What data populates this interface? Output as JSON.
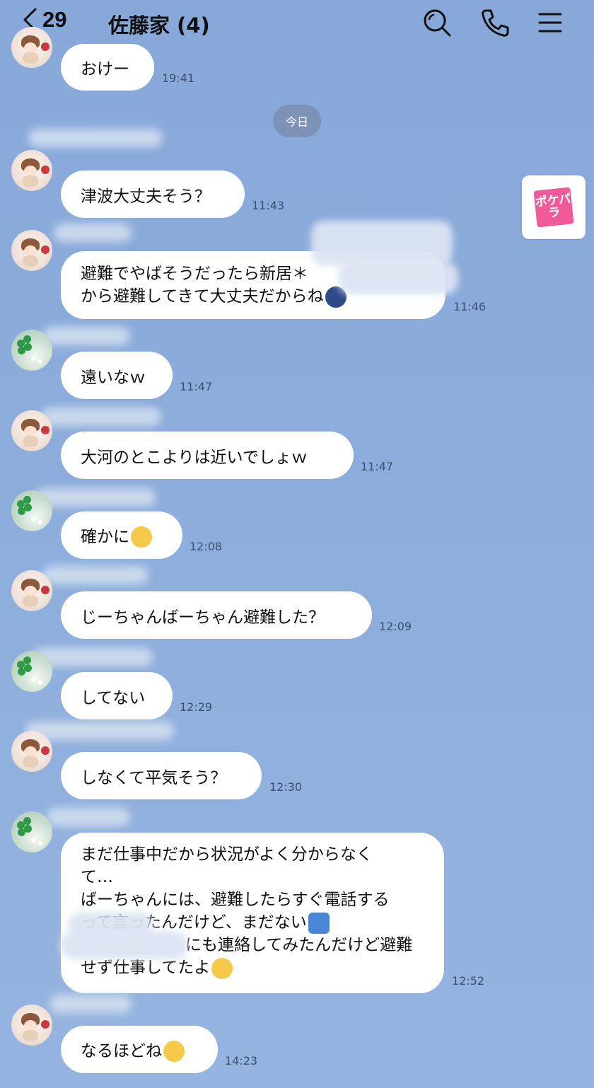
{
  "header": {
    "unread_count": "29",
    "title": "佐藤家 (4)",
    "icons": [
      "chevron-left-icon",
      "search-icon",
      "phone-icon",
      "menu-icon"
    ]
  },
  "side_widget": {
    "label": "ポケパラ"
  },
  "date_separator": "今日",
  "messages": [
    {
      "sender": "anime",
      "text": [
        "おけー"
      ],
      "time": "19:41"
    },
    {
      "sender": "anime",
      "text": [
        "津波大丈夫そう？"
      ],
      "time": "11:43"
    },
    {
      "sender": "anime",
      "text": [
        "避難でやばそうだったら新居＊",
        "から避難してきて大丈夫だからね"
      ],
      "time": "11:46"
    },
    {
      "sender": "clover",
      "text": [
        "遠いなｗ"
      ],
      "time": "11:47"
    },
    {
      "sender": "anime",
      "text": [
        "大河のとこよりは近いでしょｗ"
      ],
      "time": "11:47"
    },
    {
      "sender": "clover",
      "text": [
        "確かに"
      ],
      "time": "12:08"
    },
    {
      "sender": "anime",
      "text": [
        "じーちゃんばーちゃん避難した？"
      ],
      "time": "12:09"
    },
    {
      "sender": "clover",
      "text": [
        "してない"
      ],
      "time": "12:29"
    },
    {
      "sender": "anime",
      "text": [
        "しなくて平気そう？"
      ],
      "time": "12:30"
    },
    {
      "sender": "clover",
      "text": [
        "まだ仕事中だから状況がよく分からなく",
        "て…",
        "ばーちゃんには、避難したらすぐ電話する",
        "って言ったんだけど、まだない",
        "にも連絡してみたんだけど避難",
        "せず仕事してたよ"
      ],
      "time": "12:52"
    },
    {
      "sender": "anime",
      "text": [
        "なるほどね"
      ],
      "time": "14:23"
    }
  ],
  "colors": {
    "background": "#8aa9d8",
    "bubble": "#ffffff",
    "date_pill": "#7d92b6",
    "widget_accent": "#f05a9a"
  }
}
